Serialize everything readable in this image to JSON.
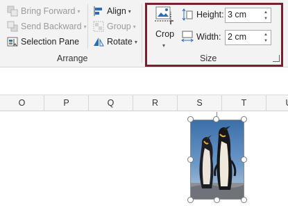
{
  "arrange": {
    "bring_forward": "Bring Forward",
    "send_backward": "Send Backward",
    "selection_pane": "Selection Pane",
    "align": "Align",
    "group": "Group",
    "rotate": "Rotate",
    "label": "Arrange"
  },
  "size": {
    "crop": "Crop",
    "height_label": "Height:",
    "height_value": "3 cm",
    "width_label": "Width:",
    "width_value": "2 cm",
    "label": "Size"
  },
  "columns": [
    "O",
    "P",
    "Q",
    "R",
    "S",
    "T",
    "U"
  ],
  "colors": {
    "highlight": "#7a1f2e",
    "accent": "#2a6ebb"
  },
  "icons": [
    "bring-forward-icon",
    "send-backward-icon",
    "selection-pane-icon",
    "align-icon",
    "group-icon",
    "rotate-icon",
    "crop-icon",
    "height-icon",
    "width-icon",
    "dialog-launcher-icon"
  ]
}
